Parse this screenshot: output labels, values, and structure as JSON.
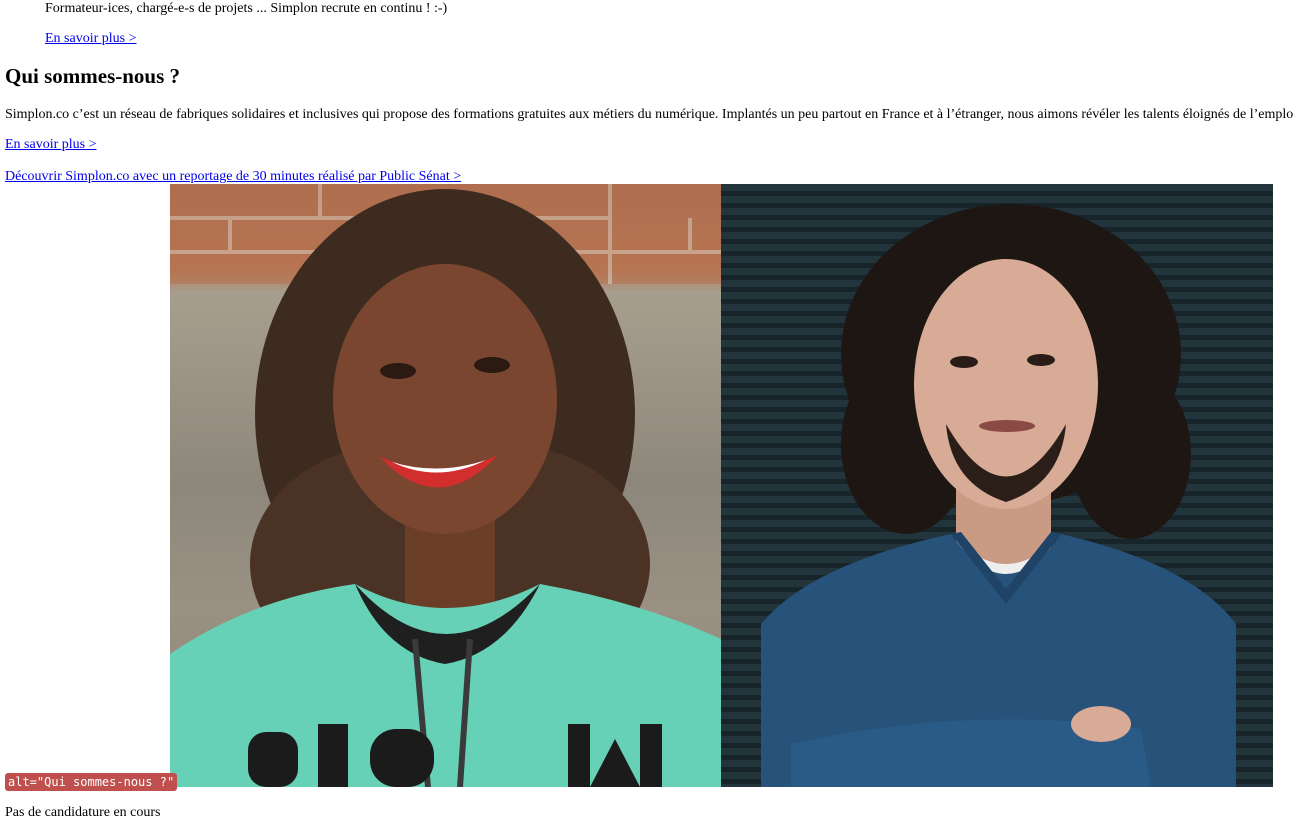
{
  "jobs": {
    "text": "Formateur-ices, chargé-e-s de projets ... Simplon recrute en continu ! :-)",
    "link": "En savoir plus >"
  },
  "about": {
    "heading": "Qui sommes-nous ?",
    "text": "Simplon.co c’est un réseau de fabriques solidaires et inclusives qui propose des formations gratuites aux métiers du numérique. Implantés un peu partout en France et à l’étranger, nous aimons révéler les talents éloignés de l’emplo",
    "link": "En savoir plus >",
    "video_link": "Découvrir Simplon.co avec un reportage de 30 minutes réalisé par Public Sénat >"
  },
  "image": {
    "alt_badge": "alt=\"Qui sommes-nous ?\""
  },
  "footer": {
    "status": "Pas de candidature en cours"
  },
  "colors": {
    "link": "#0000ee",
    "alt_badge_bg": "#c0504d"
  }
}
